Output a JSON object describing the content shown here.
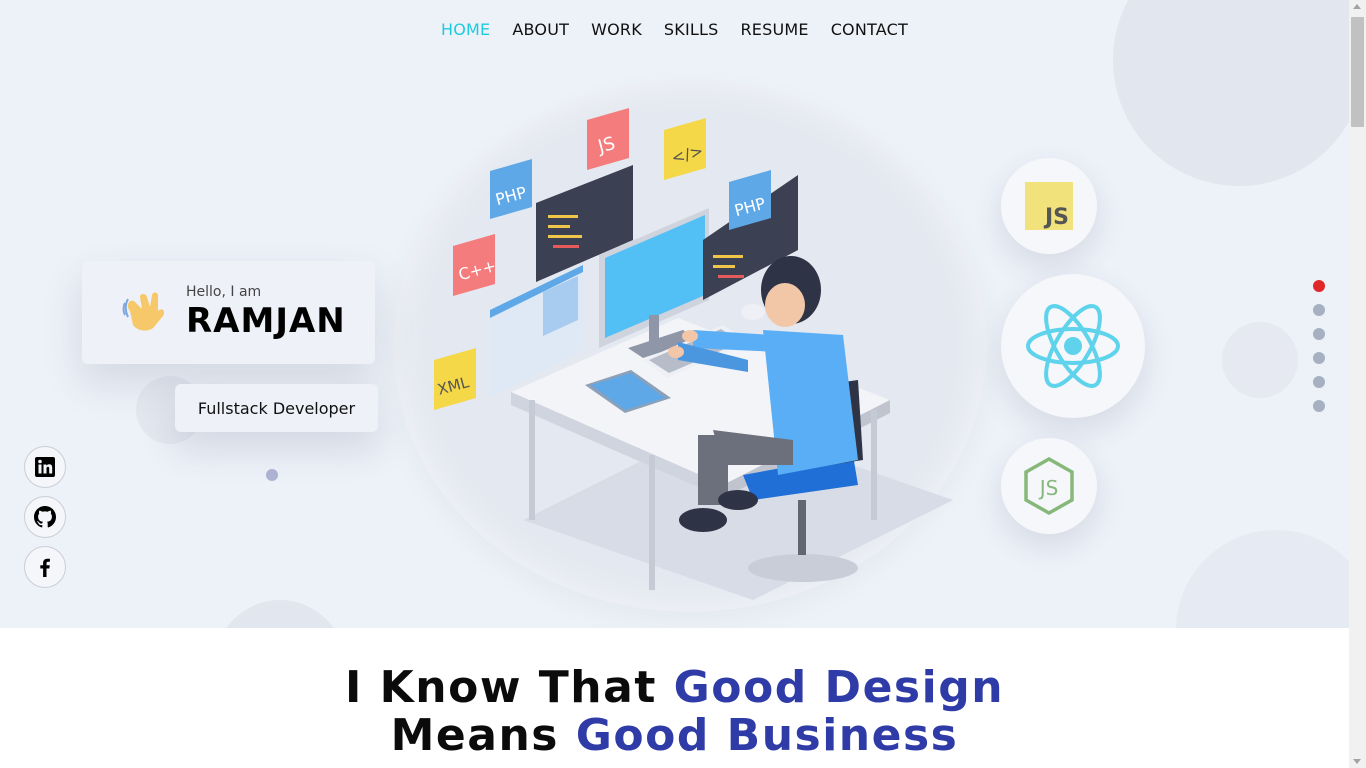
{
  "nav": {
    "items": [
      "HOME",
      "ABOUT",
      "WORK",
      "SKILLS",
      "RESUME",
      "CONTACT"
    ],
    "active": "HOME"
  },
  "intro": {
    "greeting": "Hello, I am",
    "name": "RAMJAN",
    "role": "Fullstack Developer"
  },
  "illustration": {
    "labels": [
      "PHP",
      "JS",
      "</>",
      "PHP",
      "C++",
      "XML"
    ]
  },
  "tech": {
    "js": "JS",
    "react_icon": "react-icon",
    "node": "JS"
  },
  "social": [
    "linkedin-icon",
    "github-icon",
    "facebook-icon"
  ],
  "pagination": {
    "count": 6,
    "active_index": 0
  },
  "headline": {
    "line1_a": "I Know That ",
    "line1_b": "Good Design",
    "line2_a": "Means ",
    "line2_b": "Good Business"
  },
  "colors": {
    "accent_cyan": "#1ecbe1",
    "accent_blue": "#2f3ba6",
    "active_dot": "#e0282b",
    "hero_bg": "#edf1f8"
  }
}
